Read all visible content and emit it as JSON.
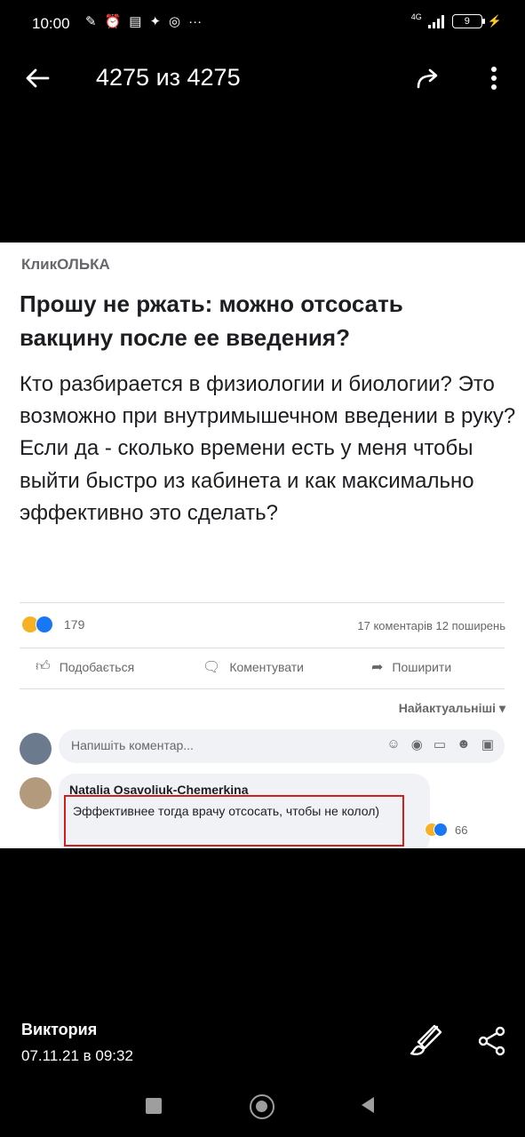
{
  "status_bar": {
    "time": "10:00",
    "network": "4G",
    "battery": "9",
    "notification_icons": [
      "wrench-icon",
      "alarm-icon",
      "message-icon",
      "twitter-icon",
      "instagram-icon",
      "more-dots-icon"
    ]
  },
  "header": {
    "title": "4275 из 4275"
  },
  "post": {
    "source": "КликОЛЬКА",
    "headline": "Прошу не ржать: можно отсосать вакцину после ее введения?",
    "body": "Кто разбирается в физиологии и биологии? Это возможно при внутримышечном введении в руку? Если да - сколько времени есть у меня чтобы выйти быстро из кабинета и как максимально эффективно это сделать?",
    "reaction_count": "179",
    "counts": "17 коментарів  12 поширень",
    "actions": {
      "like": "Подобається",
      "comment": "Коментувати",
      "share": "Поширити"
    },
    "sort_label": "Найактуальніші",
    "comment_placeholder": "Напишіть коментар...",
    "comment": {
      "author": "Natalia Osavoliuk-Chemerkina",
      "text": "Эффективнее тогда врачу отсосать, чтобы не колол)",
      "reaction_count": "66"
    }
  },
  "footer": {
    "author_name": "Виктория",
    "date": "07.11.21 в 09:32"
  },
  "colors": {
    "background": "#000000",
    "facebook_blue": "#1877f2",
    "highlight_red": "#d01f1f"
  }
}
